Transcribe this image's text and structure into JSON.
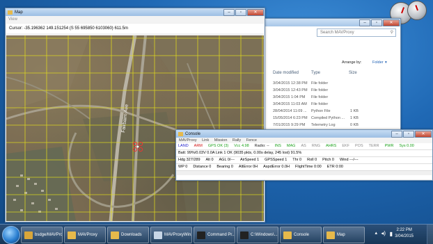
{
  "explorer": {
    "search_placeholder": "Search MAVProxy",
    "arrange_label": "Arrange by:",
    "arrange_value": "Folder",
    "columns": [
      "Date modified",
      "Type",
      "Size"
    ],
    "rows": [
      {
        "date": "3/04/2015 12:38 PM",
        "type": "File folder",
        "size": ""
      },
      {
        "date": "3/04/2015 12:43 PM",
        "type": "File folder",
        "size": ""
      },
      {
        "date": "3/04/2015 1:04 PM",
        "type": "File folder",
        "size": ""
      },
      {
        "date": "3/04/2015 11:03 AM",
        "type": "File folder",
        "size": ""
      },
      {
        "date": "28/04/2014 11:09 ...",
        "type": "Python File",
        "size": "1 KB"
      },
      {
        "date": "15/05/2014 6:23 PM",
        "type": "Compiled Python ...",
        "size": "1 KB"
      },
      {
        "date": "7/01/2015 9:29 PM",
        "type": "Telemetry Log",
        "size": "0 KB"
      }
    ]
  },
  "map": {
    "title": "Map",
    "menu": "View",
    "cursor_readout": "Cursor: -35.196362 149.151254 (S 55 695850 6103060) 611.5m",
    "road_label": "Fairbairn Ave"
  },
  "console": {
    "title": "Console",
    "menu": [
      "MAVProxy",
      "Link",
      "Mission",
      "Rally",
      "Fence"
    ],
    "status_row": [
      {
        "text": "LAND",
        "color": "#1a1acc"
      },
      {
        "text": "ARM",
        "color": "#d01010"
      },
      {
        "text": "GPS OK (3)",
        "color": "#18a018"
      },
      {
        "text": "Vcc 4.98",
        "color": "#18a018"
      },
      {
        "text": "Radio: --",
        "color": "#222222"
      },
      {
        "text": "INS",
        "color": "#18a018"
      },
      {
        "text": "MAG",
        "color": "#18a018"
      },
      {
        "text": "AS",
        "color": "#888888"
      },
      {
        "text": "RNG",
        "color": "#888888"
      },
      {
        "text": "AHRS",
        "color": "#18a018"
      },
      {
        "text": "EKF",
        "color": "#888888"
      },
      {
        "text": "POS",
        "color": "#888888"
      },
      {
        "text": "TERR",
        "color": "#888888"
      },
      {
        "text": "PWR",
        "color": "#18a018"
      },
      {
        "text": "Sys 0.00",
        "color": "#18a018"
      }
    ],
    "batt_line": "Batt: 99%/0.03V 0.0A     Link 1 OK (9035 pkts, 0.00s delay, 245 lost) 91.5%",
    "nav_row": [
      "Hdg 327/289",
      "Alt 0",
      "AGL 0/---",
      "AirSpeed 1",
      "GPSSpeed 1",
      "Thr 0",
      "Roll 0",
      "Pitch 0",
      "Wind ---/---"
    ],
    "wp_row": [
      "WP 0",
      "Distance 0",
      "Bearing 0",
      "AltError 0H",
      "AspdError 0.0H",
      "FlightTime 0:00",
      "ETR 0:00"
    ]
  },
  "taskbar": {
    "buttons": [
      {
        "label": "bsdge/MAVPro...",
        "icon_color": "#d9a63a"
      },
      {
        "label": "MAVProxy",
        "icon_color": "#e6b94b"
      },
      {
        "label": "Downloads",
        "icon_color": "#e6b94b"
      },
      {
        "label": "MAVProxyWin...",
        "icon_color": "#c8d6e6"
      },
      {
        "label": "Command Pr...",
        "icon_color": "#222222"
      },
      {
        "label": "C:\\Windows\\...",
        "icon_color": "#222222"
      },
      {
        "label": "Console",
        "icon_color": "#e6b94b"
      },
      {
        "label": "Map",
        "icon_color": "#e6b94b"
      }
    ],
    "time": "2:22 PM",
    "date": "3/04/2015"
  }
}
